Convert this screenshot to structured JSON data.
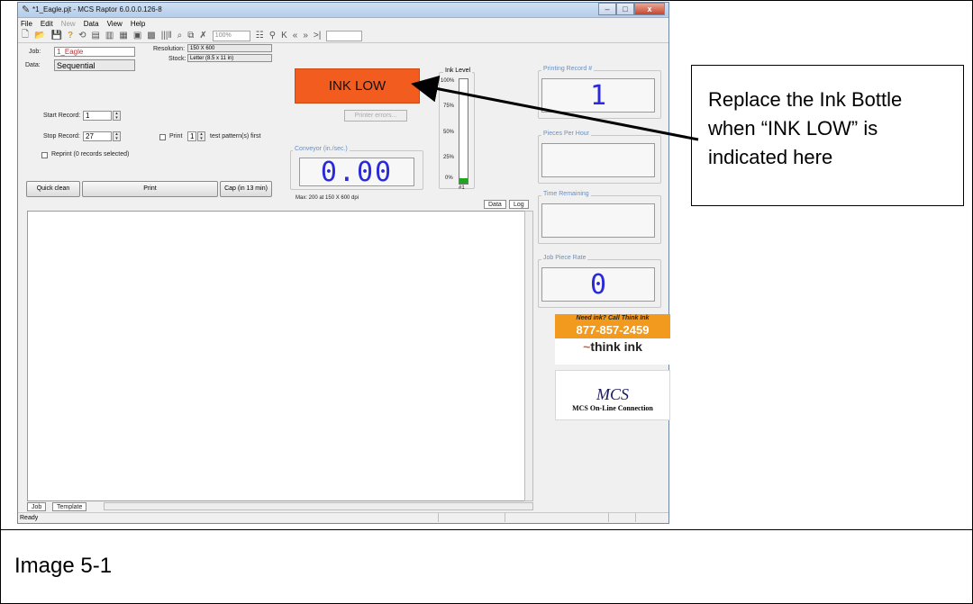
{
  "window": {
    "title": "*1_Eagle.pjt - MCS Raptor 6.0.0.0.126-8",
    "controls": {
      "minimize": "–",
      "maximize": "□",
      "close": "x"
    }
  },
  "menu": [
    "File",
    "Edit",
    "New",
    "Data",
    "View",
    "Help"
  ],
  "toolbar": {
    "zoom": "100%"
  },
  "job": {
    "job_label": "Job:",
    "job_value": "1_Eagle",
    "data_label": "Data:",
    "data_value": "Sequential",
    "resolution_label": "Resolution:",
    "resolution_value": "150 X 600",
    "stock_label": "Stock:",
    "stock_value": "Letter (8.5 x 11 in)",
    "start_record_label": "Start Record:",
    "start_record_value": "1",
    "stop_record_label": "Stop Record:",
    "stop_record_value": "27",
    "print_label": "Print",
    "print_value": "1",
    "test_pattern_label": "test pattern(s) first",
    "reprint_label": "Reprint (0 records selected)"
  },
  "buttons": {
    "quick_clean": "Quick clean",
    "print": "Print",
    "cap": "Cap (in 13 min)",
    "printer_errors": "Printer errors..."
  },
  "status_banner": "INK LOW",
  "conveyor": {
    "title": "Conveyor (in./sec.)",
    "value": "0.00",
    "max_note": "Max: 200 at 150 X 600 dpi"
  },
  "ink_level": {
    "title": "Ink Level",
    "ticks": [
      "100%",
      "75%",
      "50%",
      "25%",
      "0%"
    ],
    "cartridge": "#1",
    "level_fraction": 0.05,
    "fill_color": "#22a322"
  },
  "side_panels": {
    "printing_record": {
      "title": "Printing Record #",
      "value": "1"
    },
    "pieces_per_hour": {
      "title": "Pieces Per Hour",
      "value": ""
    },
    "time_remaining": {
      "title": "Time Remaining",
      "value": ""
    },
    "job_piece_rate": {
      "title": "Job Piece Rate",
      "value": "0"
    }
  },
  "tabs": {
    "data": "Data",
    "log": "Log",
    "job": "Job",
    "template": "Template"
  },
  "statusbar": {
    "text": "Ready"
  },
  "ads": {
    "think_ink_tagline": "Need ink? Call Think Ink",
    "think_ink_phone": "877-857-2459",
    "think_ink_brand": "think ink",
    "mcs_logo": "MCS",
    "mcs_caption": "MCS On-Line Connection"
  },
  "callout": {
    "text": "Replace the Ink Bottle when “INK LOW” is indicated here"
  },
  "caption": "Image 5-1",
  "colors": {
    "ink_low_bg": "#f25c1e",
    "lcd_digits": "#2a2ad8",
    "think_ink_orange": "#f29a1e"
  }
}
